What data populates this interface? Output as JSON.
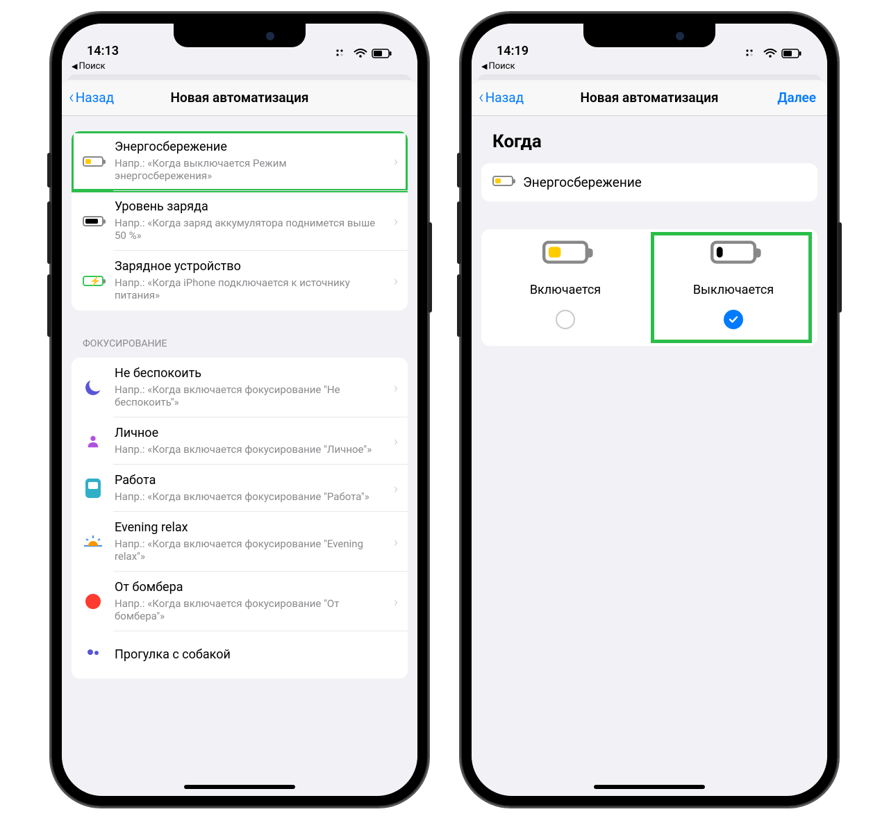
{
  "left": {
    "status": {
      "time": "14:13",
      "breadcrumb": "Поиск"
    },
    "nav": {
      "back": "Назад",
      "title": "Новая автоматизация"
    },
    "triggers": [
      {
        "icon": "battery-low-power",
        "title": "Энергосбережение",
        "sub": "Напр.: «Когда выключается Режим энергосбережения»",
        "highlight": true
      },
      {
        "icon": "battery-level",
        "title": "Уровень заряда",
        "sub": "Напр.: «Когда заряд аккумулятора поднимется выше 50 %»"
      },
      {
        "icon": "charger",
        "title": "Зарядное устройство",
        "sub": "Напр.: «Когда iPhone подключается к источнику питания»"
      }
    ],
    "focus_header": "ФОКУСИРОВАНИЕ",
    "focus": [
      {
        "icon": "moon",
        "title": "Не беспокоить",
        "sub": "Напр.: «Когда включается фокусирование \"Не беспокоить\"»"
      },
      {
        "icon": "person",
        "title": "Личное",
        "sub": "Напр.: «Когда включается фокусирование \"Личное\"»"
      },
      {
        "icon": "badge",
        "title": "Работа",
        "sub": "Напр.: «Когда включается фокусирование \"Работа\"»"
      },
      {
        "icon": "sunset",
        "title": "Evening relax",
        "sub": "Напр.: «Когда включается фокусирование \"Evening relax\"»"
      },
      {
        "icon": "reddot",
        "title": "От бомбера",
        "sub": "Напр.: «Когда включается фокусирование \"От бомбера\"»"
      },
      {
        "icon": "people",
        "title": "Прогулка с собакой",
        "sub": ""
      }
    ]
  },
  "right": {
    "status": {
      "time": "14:19",
      "breadcrumb": "Поиск"
    },
    "nav": {
      "back": "Назад",
      "title": "Новая автоматизация",
      "next": "Далее"
    },
    "heading": "Когда",
    "trigger_label": "Энергосбережение",
    "options": {
      "on": {
        "label": "Включается",
        "selected": false
      },
      "off": {
        "label": "Выключается",
        "selected": true,
        "highlight": true
      }
    }
  },
  "colors": {
    "accent": "#007aff",
    "highlight": "#2bbe4a",
    "yellow": "#ffcc00"
  }
}
